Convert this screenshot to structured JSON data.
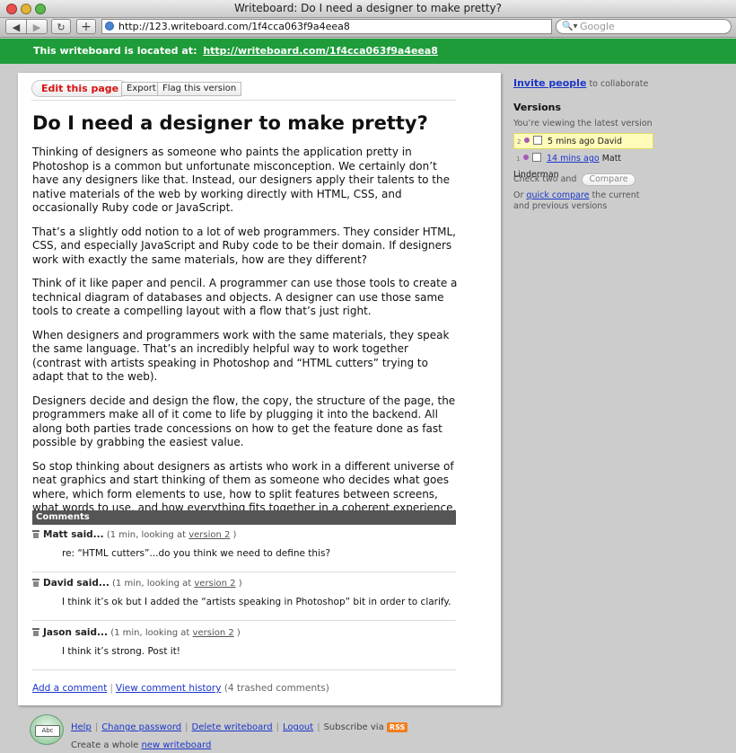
{
  "window": {
    "title": "Writeboard: Do I need a designer to make pretty?"
  },
  "toolbar": {
    "back_icon": "back-arrow-icon",
    "forward_icon": "forward-arrow-icon",
    "reload_icon": "reload-icon",
    "add_icon": "plus-icon",
    "url": "http://123.writeboard.com/1f4cca063f9a4eea8",
    "search_placeholder": "Google"
  },
  "banner": {
    "text": "This writeboard is located at:",
    "link": "http://writeboard.com/1f4cca063f9a4eea8",
    "color": "#1e9c3a"
  },
  "document": {
    "edit_label": "Edit this page",
    "export_label": "Export",
    "flag_label": "Flag this version",
    "title": "Do I need a designer to make pretty?",
    "paragraphs": [
      "Thinking of designers as someone who paints the application pretty in Photoshop is a common but unfortunate misconception. We certainly don’t have any designers like that. Instead, our designers apply their talents to the native materials of the web by working directly with HTML, CSS, and occasionally Ruby code or JavaScript.",
      "That’s a slightly odd notion to a lot of web programmers. They consider HTML, CSS, and especially JavaScript and Ruby code to be their domain. If designers work with exactly the same materials, how are they different?",
      "Think of it like paper and pencil. A programmer can use those tools to create a technical diagram of databases and objects. A designer can use those same tools to create a compelling layout with a flow that’s just right.",
      "When designers and programmers work with the same materials, they speak the same language. That’s an incredibly helpful way to work together (contrast with artists speaking in Photoshop and “HTML cutters” trying to adapt that to the web).",
      "Designers decide and design the flow, the copy, the structure of the page, the programmers make all of it come to life by plugging it into the backend. All along both parties trade concessions on how to get the feature done as fast possible by grabbing the easiest value.",
      "So stop thinking about designers as artists who work in a different universe of neat graphics and start thinking of them as someone who decides what goes where, which form elements to use, how to split features between screens, what words to use, and how everything fits together in a coherent experience."
    ]
  },
  "comments": {
    "heading": "Comments",
    "items": [
      {
        "author": "Matt said...",
        "meta_pre": "(1 min, looking at",
        "version": "version 2",
        "meta_post": ")",
        "text": "re: “HTML cutters”...do you think we need to define this?"
      },
      {
        "author": "David said...",
        "meta_pre": "(1 min, looking at",
        "version": "version 2",
        "meta_post": ")",
        "text": "I think it’s ok but I added the “artists speaking in Photoshop” bit in order to clarify."
      },
      {
        "author": "Jason said...",
        "meta_pre": "(1 min, looking at",
        "version": "version 2",
        "meta_post": ")",
        "text": "I think it’s strong. Post it!"
      }
    ],
    "add_label": "Add a comment",
    "history_label": "View comment history",
    "trashed": "(4 trashed comments)"
  },
  "sidebar": {
    "invite_label": "Invite people",
    "invite_suffix": "to collaborate",
    "versions_heading": "Versions",
    "viewing": "You’re viewing the latest version",
    "versions": [
      {
        "num": "2",
        "time": "5 mins ago",
        "author": "David"
      },
      {
        "num": "1",
        "time": "14 mins ago",
        "author": "Matt Linderman"
      }
    ],
    "check_two": "Check two and",
    "compare_label": "Compare",
    "or_text": "Or",
    "quick_compare": "quick compare",
    "or_suffix": "the current and previous versions"
  },
  "footer": {
    "logo_text": "Abc",
    "help": "Help",
    "change_password": "Change password",
    "delete": "Delete writeboard",
    "logout": "Logout",
    "subscribe": "Subscribe via",
    "rss": "RSS",
    "create_prefix": "Create a whole",
    "new_writeboard": "new writeboard"
  }
}
